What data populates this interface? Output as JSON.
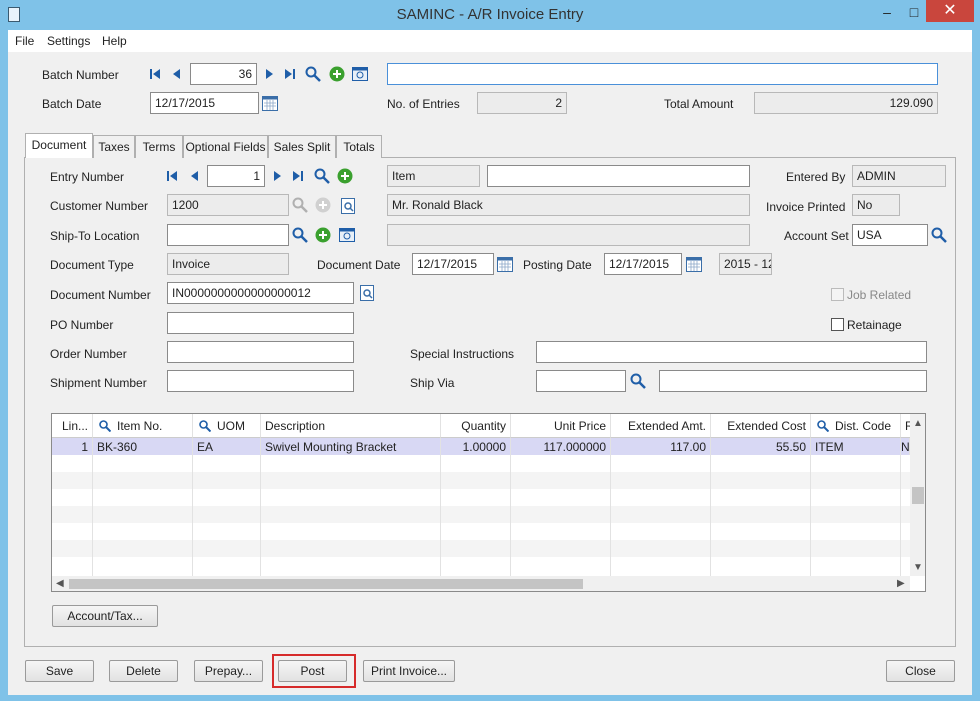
{
  "window": {
    "title": "SAMINC - A/R Invoice Entry",
    "minimize": "–",
    "maximize": "□",
    "close": "✕"
  },
  "menu": {
    "file": "File",
    "settings": "Settings",
    "help": "Help"
  },
  "batch": {
    "number_label": "Batch Number",
    "number": "36",
    "description": "",
    "date_label": "Batch Date",
    "date": "12/17/2015",
    "entries_label": "No. of Entries",
    "entries": "2",
    "total_label": "Total Amount",
    "total": "129.090"
  },
  "tabs": [
    "Document",
    "Taxes",
    "Terms",
    "Optional Fields",
    "Sales Split",
    "Totals"
  ],
  "entry": {
    "entry_number_label": "Entry Number",
    "entry_number": "1",
    "doc_kind": "Item",
    "entry_description": "",
    "entered_by_label": "Entered By",
    "entered_by": "ADMIN",
    "customer_label": "Customer Number",
    "customer": "1200",
    "customer_name": "Mr. Ronald Black",
    "invoice_printed_label": "Invoice Printed",
    "invoice_printed": "No",
    "shipto_label": "Ship-To Location",
    "shipto": "",
    "shipto_desc": "",
    "account_set_label": "Account Set",
    "account_set": "USA",
    "doctype_label": "Document Type",
    "doctype": "Invoice",
    "docdate_label": "Document Date",
    "docdate": "12/17/2015",
    "postdate_label": "Posting Date",
    "postdate": "12/17/2015",
    "period": "2015 - 12",
    "docnum_label": "Document Number",
    "docnum": "IN0000000000000000012",
    "job_related_label": "Job Related",
    "retainage_label": "Retainage",
    "po_label": "PO Number",
    "po": "",
    "order_label": "Order Number",
    "order": "",
    "special_label": "Special Instructions",
    "special": "",
    "shipment_label": "Shipment Number",
    "shipment": "",
    "shipvia_label": "Ship Via",
    "shipvia": "",
    "shipvia_desc": ""
  },
  "grid": {
    "columns": [
      "Lin...",
      "Item No.",
      "UOM",
      "Description",
      "Quantity",
      "Unit Price",
      "Extended Amt.",
      "Extended Cost",
      "Dist. Code",
      "R"
    ],
    "rows": [
      [
        "1",
        "BK-360",
        "EA",
        "Swivel Mounting Bracket",
        "1.00000",
        "117.000000",
        "117.00",
        "55.50",
        "ITEM",
        "N"
      ]
    ]
  },
  "buttons": {
    "account_tax": "Account/Tax...",
    "save": "Save",
    "delete": "Delete",
    "prepay": "Prepay...",
    "post": "Post",
    "print_invoice": "Print Invoice...",
    "close": "Close"
  },
  "colors": {
    "title_bar": "#7fc2e8",
    "close_button": "#c9463d",
    "selected_row": "#d8d8f4",
    "highlight_box": "#d62b2b"
  }
}
